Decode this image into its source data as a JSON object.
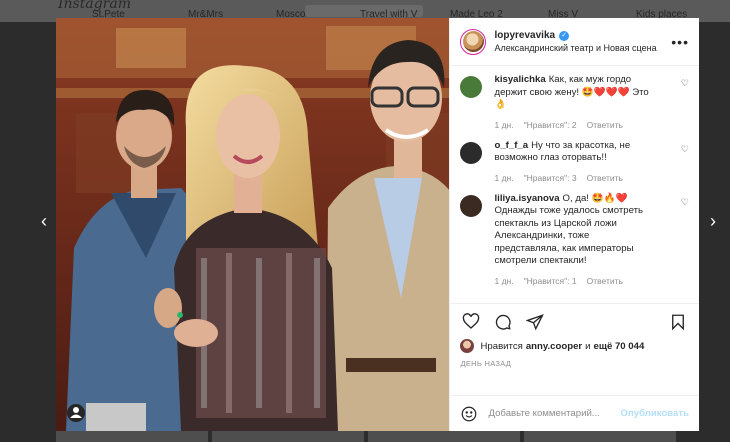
{
  "background": {
    "logo": "Instagram",
    "stories": [
      "St.Pete",
      "Mr&Mrs",
      "Moscow",
      "Travel with V",
      "Made Leo 2",
      "Miss V",
      "Kids places"
    ]
  },
  "post": {
    "username": "lopyrevavika",
    "verified": true,
    "location": "Александринский театр и Новая сцена",
    "more_icon": "more-horizontal-icon"
  },
  "comments": [
    {
      "user": "kisyalichka",
      "text": "Как, как муж гордо держит свою жену! 🤩❤️❤️❤️ Это 👌",
      "time": "1 дн.",
      "likes": "\"Нравится\": 2",
      "reply": "Ответить",
      "avatar_color": "#4a7a3a"
    },
    {
      "user": "o_f_f_a",
      "text": "Ну что за красотка, не возможно глаз оторвать!!",
      "time": "1 дн.",
      "likes": "\"Нравится\": 3",
      "reply": "Ответить",
      "avatar_color": "#2b2b2b"
    },
    {
      "user": "liliya.isyanova",
      "text": "О, да! 🤩🔥❤️ Однажды тоже удалось смотреть спектакль из Царской ложи Александринки, тоже представляла, как императоры смотрели спектакли!",
      "time": "1 дн.",
      "likes": "\"Нравится\": 1",
      "reply": "Ответить",
      "avatar_color": "#3a2a22"
    }
  ],
  "likes": {
    "prefix": "Нравится",
    "user": "anny.cooper",
    "middle": "и",
    "count": "ещё 70 044"
  },
  "time_ago": "ДЕНЬ НАЗАД",
  "add_comment": {
    "placeholder": "Добавьте комментарий...",
    "publish": "Опубликовать"
  },
  "colors": {
    "accent": "#3897f0",
    "publish_disabled": "#b2dffc",
    "text": "#262626",
    "muted": "#8e8e8e"
  }
}
